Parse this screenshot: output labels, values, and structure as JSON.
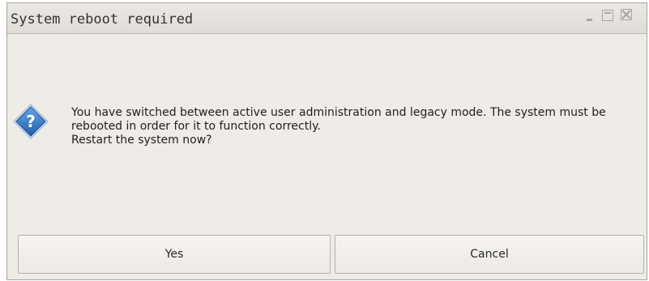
{
  "window": {
    "title": "System reboot required",
    "controls": {
      "minimize_icon": "minimize-icon",
      "maximize_icon": "maximize-icon",
      "close_icon": "close-icon"
    }
  },
  "message": {
    "icon": "question-icon",
    "lines": [
      "You have switched between active user administration and legacy mode. The system must be",
      "rebooted in order for it to function correctly.",
      "Restart the system now?"
    ]
  },
  "buttons": {
    "yes_label": "Yes",
    "cancel_label": "Cancel"
  },
  "colors": {
    "dialog_background": "#efebe7",
    "icon_blue": "#2c6fbb"
  }
}
